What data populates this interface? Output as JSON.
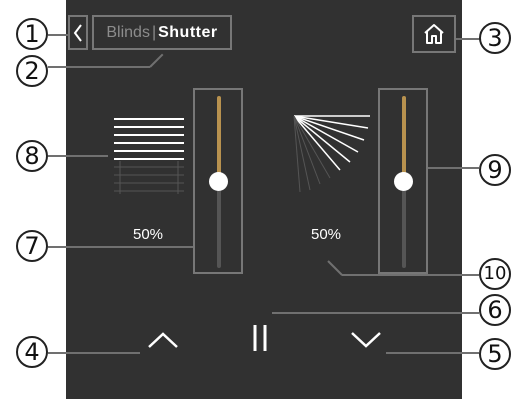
{
  "header": {
    "tab_blinds": "Blinds",
    "separator": "|",
    "tab_shutter": "Shutter"
  },
  "sliders": {
    "position": {
      "value_label": "50%",
      "level": 0.5
    },
    "angle": {
      "value_label": "50%",
      "level": 0.5
    }
  },
  "controls": {
    "up_icon": "chevron-up-icon",
    "stop_icon": "pause-icon",
    "down_icon": "chevron-down-icon"
  },
  "callouts": [
    "1",
    "2",
    "3",
    "4",
    "5",
    "6",
    "7",
    "8",
    "9",
    "10"
  ],
  "colors": {
    "background": "#313131",
    "frame": "#777777",
    "track_active": "#b8924f",
    "track_inactive": "#555555",
    "text": "#ffffff",
    "text_dim": "#8c8c8c"
  }
}
